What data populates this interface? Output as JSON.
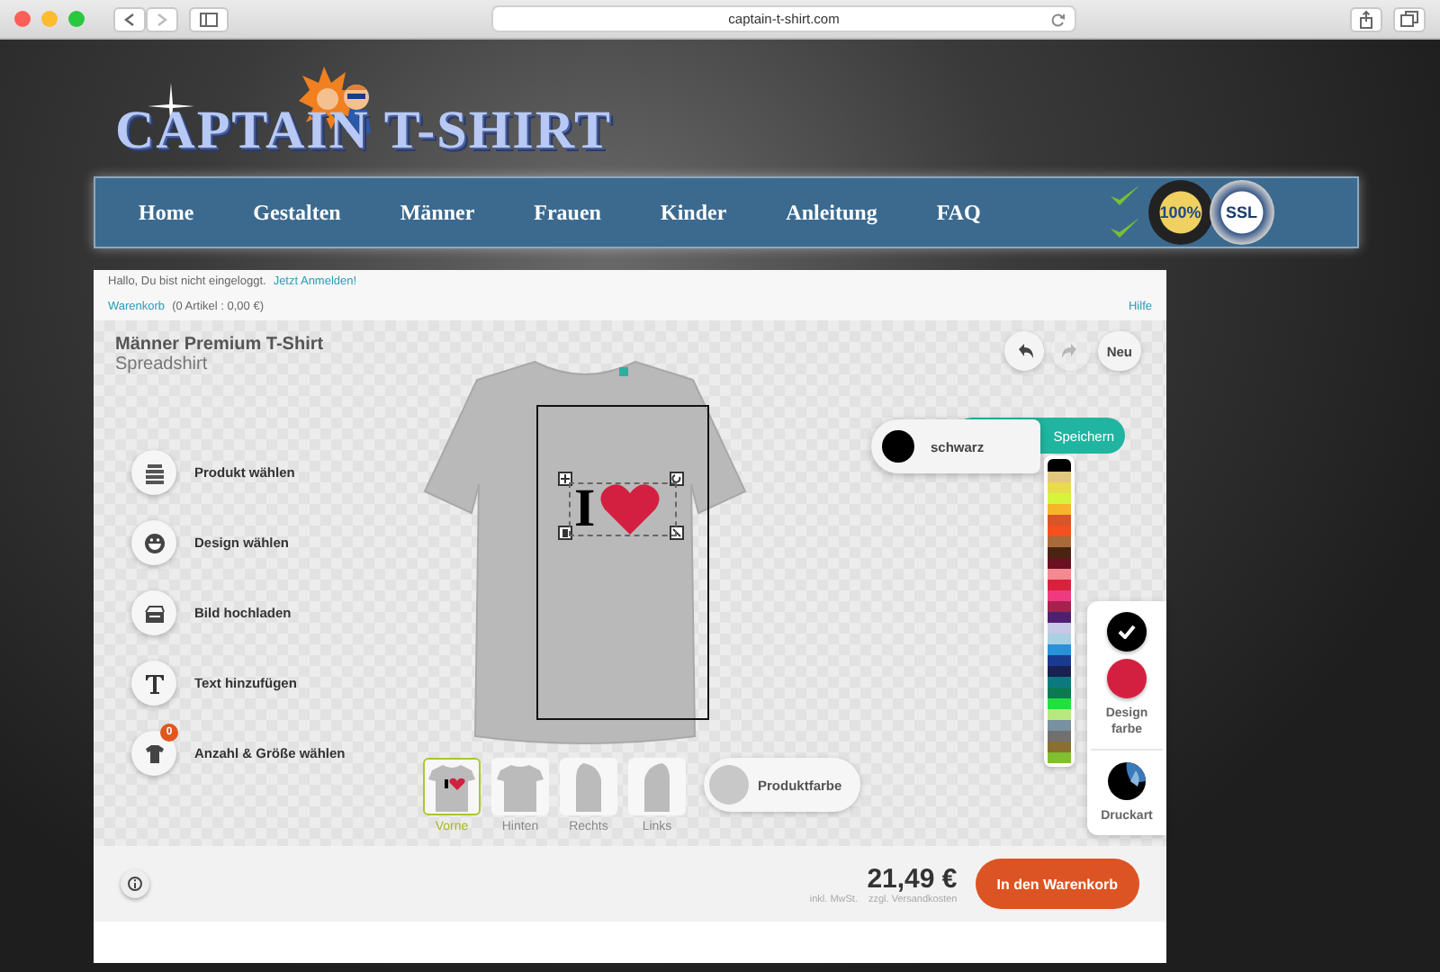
{
  "browser": {
    "url": "captain-t-shirt.com"
  },
  "logo": {
    "text": "CAPTAIN T-SHIRT"
  },
  "nav": {
    "items": [
      "Home",
      "Gestalten",
      "Männer",
      "Frauen",
      "Kinder",
      "Anleitung",
      "FAQ"
    ],
    "badges": [
      "100%",
      "SSL"
    ]
  },
  "session": {
    "greeting": "Hallo, Du bist nicht eingeloggt.",
    "login_link": "Jetzt Anmelden!",
    "cart_link": "Warenkorb",
    "cart_summary": "(0 Artikel : 0,00 €)",
    "help_link": "Hilfe"
  },
  "product": {
    "name": "Männer Premium T-Shirt",
    "brand": "Spreadshirt"
  },
  "toolbar": [
    {
      "kind": "undo",
      "disabled": false
    },
    {
      "kind": "redo",
      "disabled": true
    },
    {
      "kind": "text",
      "label": "Neu",
      "disabled": false
    }
  ],
  "tools": [
    {
      "kind": "product",
      "label": "Produkt wählen"
    },
    {
      "kind": "design",
      "label": "Design wählen"
    },
    {
      "kind": "upload",
      "label": "Bild hochladen"
    },
    {
      "kind": "text",
      "label": "Text hinzufügen"
    },
    {
      "kind": "size",
      "label": "Anzahl & Größe wählen",
      "badge": "0"
    }
  ],
  "design": {
    "text": "I",
    "selected": true
  },
  "save_button": {
    "label": "Speichern"
  },
  "color_picker": {
    "selected_name": "schwarz",
    "colors": [
      {
        "color": "#000000",
        "selected": true
      },
      {
        "color": "#e3c77f",
        "selected": false
      },
      {
        "color": "#e8dc4a",
        "selected": false
      },
      {
        "color": "#d4f53a",
        "selected": false
      },
      {
        "color": "#f7b52a",
        "selected": false
      },
      {
        "color": "#d9542a",
        "selected": false
      },
      {
        "color": "#f5501e",
        "selected": false
      },
      {
        "color": "#a86a3a",
        "selected": false
      },
      {
        "color": "#4a2410",
        "selected": false
      },
      {
        "color": "#6a1020",
        "selected": false
      },
      {
        "color": "#f48a90",
        "selected": false
      },
      {
        "color": "#d9203c",
        "selected": false
      },
      {
        "color": "#f03a80",
        "selected": false
      },
      {
        "color": "#a8204e",
        "selected": false
      },
      {
        "color": "#502070",
        "selected": false
      },
      {
        "color": "#c8c8e8",
        "selected": false
      },
      {
        "color": "#a8d0e0",
        "selected": false
      },
      {
        "color": "#2a90d8",
        "selected": false
      },
      {
        "color": "#1a3a90",
        "selected": false
      },
      {
        "color": "#1a2050",
        "selected": false
      },
      {
        "color": "#0a7a80",
        "selected": false
      },
      {
        "color": "#0a7a50",
        "selected": false
      },
      {
        "color": "#20e040",
        "selected": false
      },
      {
        "color": "#b8e880",
        "selected": false
      },
      {
        "color": "#7890a0",
        "selected": false
      },
      {
        "color": "#707070",
        "selected": false
      },
      {
        "color": "#8a7030",
        "selected": false
      },
      {
        "color": "#80c030",
        "selected": false
      }
    ]
  },
  "design_colors": {
    "label": "Design farbe",
    "items": [
      {
        "color": "#000000",
        "selected": true
      },
      {
        "color": "#d42040",
        "selected": false
      }
    ]
  },
  "print_type": {
    "label": "Druckart"
  },
  "views": [
    {
      "kind": "front",
      "label": "Vorne",
      "selected": true
    },
    {
      "kind": "back",
      "label": "Hinten",
      "selected": false
    },
    {
      "kind": "right",
      "label": "Rechts",
      "selected": false
    },
    {
      "kind": "left",
      "label": "Links",
      "selected": false
    }
  ],
  "product_color_button": {
    "label": "Produktfarbe"
  },
  "footer": {
    "price": "21,49 €",
    "tax_note": "inkl. MwSt.",
    "shipping_note": "zzgl. Versandkosten",
    "cart_button": "In den Warenkorb"
  }
}
